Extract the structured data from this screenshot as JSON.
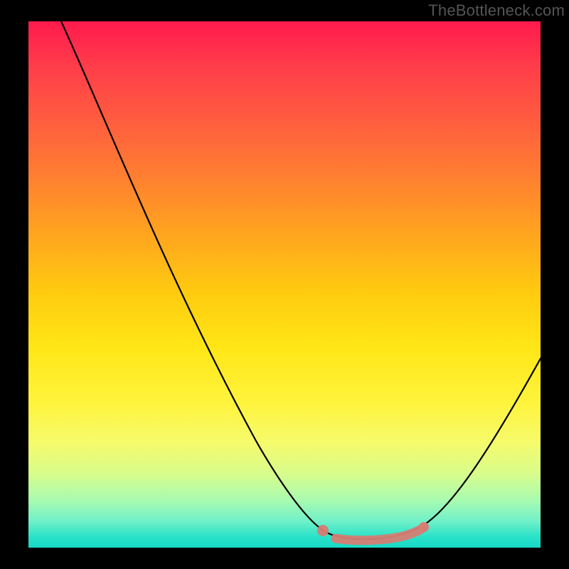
{
  "watermark": "TheBottleneck.com",
  "chart_data": {
    "type": "line",
    "title": "",
    "xlabel": "",
    "ylabel": "",
    "xlim": [
      0,
      100
    ],
    "ylim": [
      0,
      100
    ],
    "grid": false,
    "legend": false,
    "series": [
      {
        "name": "bottleneck-curve",
        "color": "#000000",
        "x": [
          6,
          12,
          20,
          30,
          40,
          48,
          55,
          58,
          62,
          66,
          70,
          76,
          82,
          90,
          100
        ],
        "values": [
          100,
          82,
          64,
          44,
          26,
          13,
          5,
          2,
          1,
          1,
          3,
          7,
          14,
          25,
          36
        ]
      },
      {
        "name": "optimal-range-highlight",
        "color": "#d77d74",
        "x": [
          58,
          62,
          66,
          70,
          74,
          77
        ],
        "values": [
          3,
          1,
          1,
          2,
          3,
          4
        ]
      }
    ],
    "background_gradient": {
      "orientation": "vertical",
      "stops": [
        {
          "pos": 0.0,
          "color": "#ff1a4d"
        },
        {
          "pos": 0.28,
          "color": "#ff7a33"
        },
        {
          "pos": 0.52,
          "color": "#ffcc0f"
        },
        {
          "pos": 0.8,
          "color": "#f6fb6b"
        },
        {
          "pos": 1.0,
          "color": "#17d8c6"
        }
      ]
    }
  },
  "colors": {
    "page_background": "#000000",
    "curve": "#000000",
    "highlight": "#d77d74",
    "watermark": "#555555"
  }
}
